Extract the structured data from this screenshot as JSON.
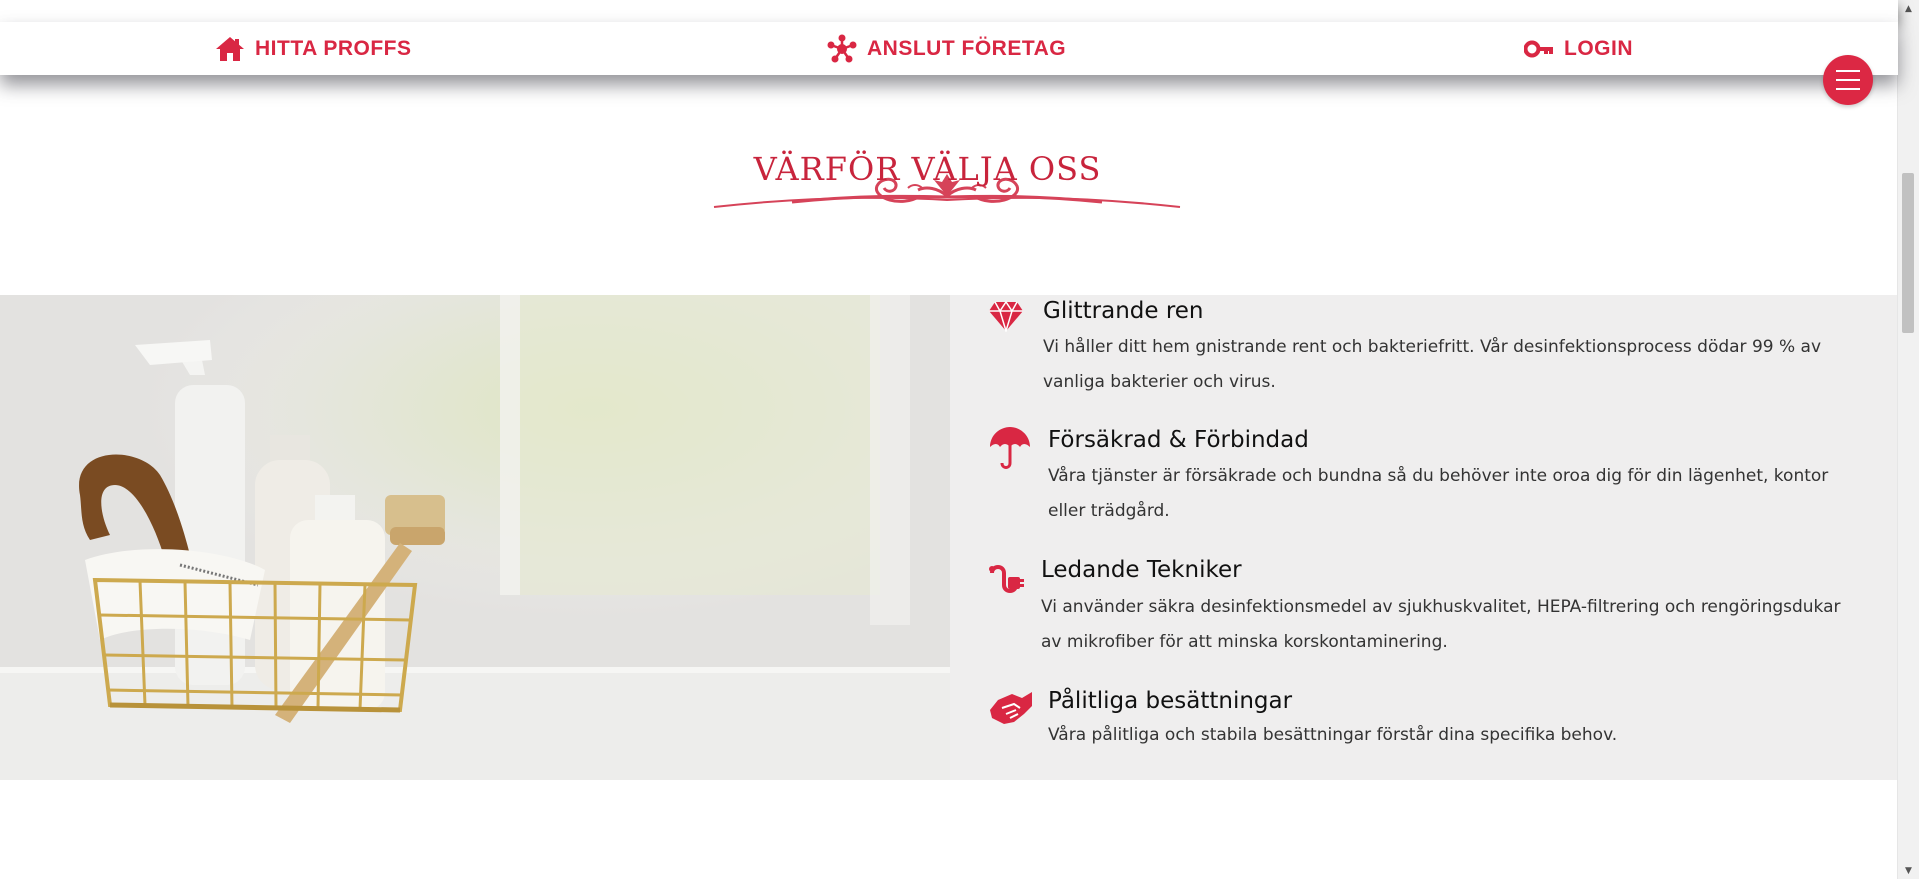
{
  "nav": {
    "items": [
      {
        "label": "HITTA PROFFS",
        "icon": "house-icon"
      },
      {
        "label": "ANSLUT FÖRETAG",
        "icon": "network-icon"
      },
      {
        "label": "LOGIN",
        "icon": "key-icon"
      }
    ],
    "menu_icon": "hamburger-menu-icon"
  },
  "section": {
    "title": "VÄRFÖR VÄLJA OSS"
  },
  "features": [
    {
      "title": "Glittrande ren",
      "text": "Vi håller ditt hem gnistrande rent och bakteriefritt. Vår desinfektionsprocess dödar 99 % av vanliga bakterier och virus.",
      "icon": "diamond-icon"
    },
    {
      "title": "Försäkrad & Förbindad",
      "text": "Våra tjänster är försäkrade och bundna så du behöver inte oroa dig för din lägenhet, kontor eller trädgård.",
      "icon": "umbrella-icon"
    },
    {
      "title": "Ledande Tekniker",
      "text": "Vi använder säkra desinfektionsmedel av sjukhuskvalitet, HEPA-filtrering och rengöringsdukar av mikrofiber för att minska korskontaminering.",
      "icon": "plug-icon"
    },
    {
      "title": "Pålitliga besättningar",
      "text": "Våra pålitliga och stabila besättningar förstår dina specifika behov.",
      "icon": "handshake-icon"
    }
  ],
  "colors": {
    "accent": "#d92743",
    "section_bg": "#efeeee"
  }
}
